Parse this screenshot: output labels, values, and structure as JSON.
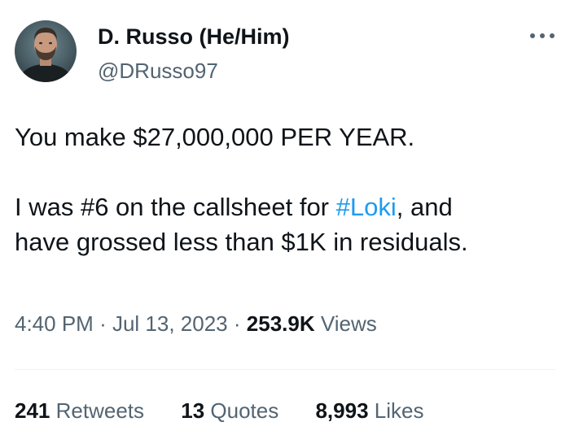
{
  "author": {
    "display_name": "D. Russo (He/Him)",
    "handle": "@DRusso97"
  },
  "more_icon": "more-horizontal-icon",
  "tweet": {
    "line1": "You make $27,000,000 PER YEAR.",
    "line2_before": "I was #6 on the callsheet for ",
    "hashtag": "#Loki",
    "line2_after": ", and",
    "line3": "have grossed less than $1K in residuals."
  },
  "meta": {
    "time": "4:40 PM",
    "separator": "·",
    "date": "Jul 13, 2023",
    "views_count": "253.9K",
    "views_label": "Views"
  },
  "stats": {
    "retweets_count": "241",
    "retweets_label": "Retweets",
    "quotes_count": "13",
    "quotes_label": "Quotes",
    "likes_count": "8,993",
    "likes_label": "Likes"
  },
  "colors": {
    "text": "#0f1419",
    "secondary": "#536471",
    "link": "#1d9bf0",
    "divider": "#eff3f4"
  }
}
